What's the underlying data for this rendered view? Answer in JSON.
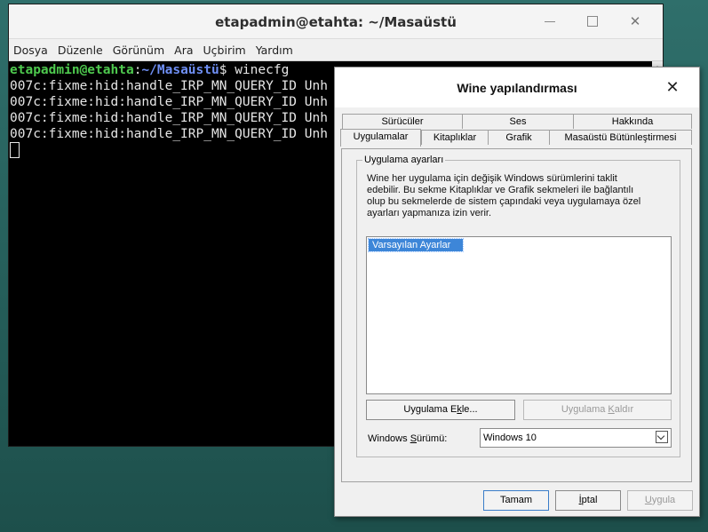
{
  "terminal": {
    "title": "etapadmin@etahta: ~/Masaüstü",
    "menu": [
      "Dosya",
      "Düzenle",
      "Görünüm",
      "Ara",
      "Uçbirim",
      "Yardım"
    ],
    "prompt_user": "etapadmin@etahta",
    "prompt_sep": ":",
    "prompt_path": "~/Masaüstü",
    "prompt_end": "$ ",
    "command": "winecfg",
    "output_lines": [
      "007c:fixme:hid:handle_IRP_MN_QUERY_ID Unh",
      "007c:fixme:hid:handle_IRP_MN_QUERY_ID Unh",
      "007c:fixme:hid:handle_IRP_MN_QUERY_ID Unh",
      "007c:fixme:hid:handle_IRP_MN_QUERY_ID Unh"
    ],
    "close_glyph": "✕"
  },
  "wine": {
    "title": "Wine yapılandırması",
    "close_glyph": "✕",
    "tabs_row1": [
      "Sürücüler",
      "Ses",
      "Hakkında"
    ],
    "tabs_row2": [
      "Uygulamalar",
      "Kitaplıklar",
      "Grafik",
      "Masaüstü Bütünleştirmesi"
    ],
    "active_tab": "Uygulamalar",
    "group_label": "Uygulama ayarları",
    "description": "Wine her uygulama için değişik Windows sürümlerini taklit edebilir. Bu sekme Kitaplıklar ve Grafik sekmeleri ile bağlantılı olup bu sekmelerde de sistem çapındaki veya uygulamaya özel ayarları yapmanıza izin verir.",
    "list_items": [
      "Varsayılan Ayarlar"
    ],
    "add_app_pre": "Uygulama E",
    "add_app_acc": "k",
    "add_app_post": "le...",
    "remove_app_pre": "Uygulama ",
    "remove_app_acc": "K",
    "remove_app_post": "aldır",
    "version_pre": "Windows ",
    "version_acc": "S",
    "version_post": "ürümü:",
    "version_value": "Windows 10",
    "ok_label": "Tamam",
    "cancel_acc": "İ",
    "cancel_post": "ptal",
    "apply_acc": "U",
    "apply_post": "ygula"
  }
}
